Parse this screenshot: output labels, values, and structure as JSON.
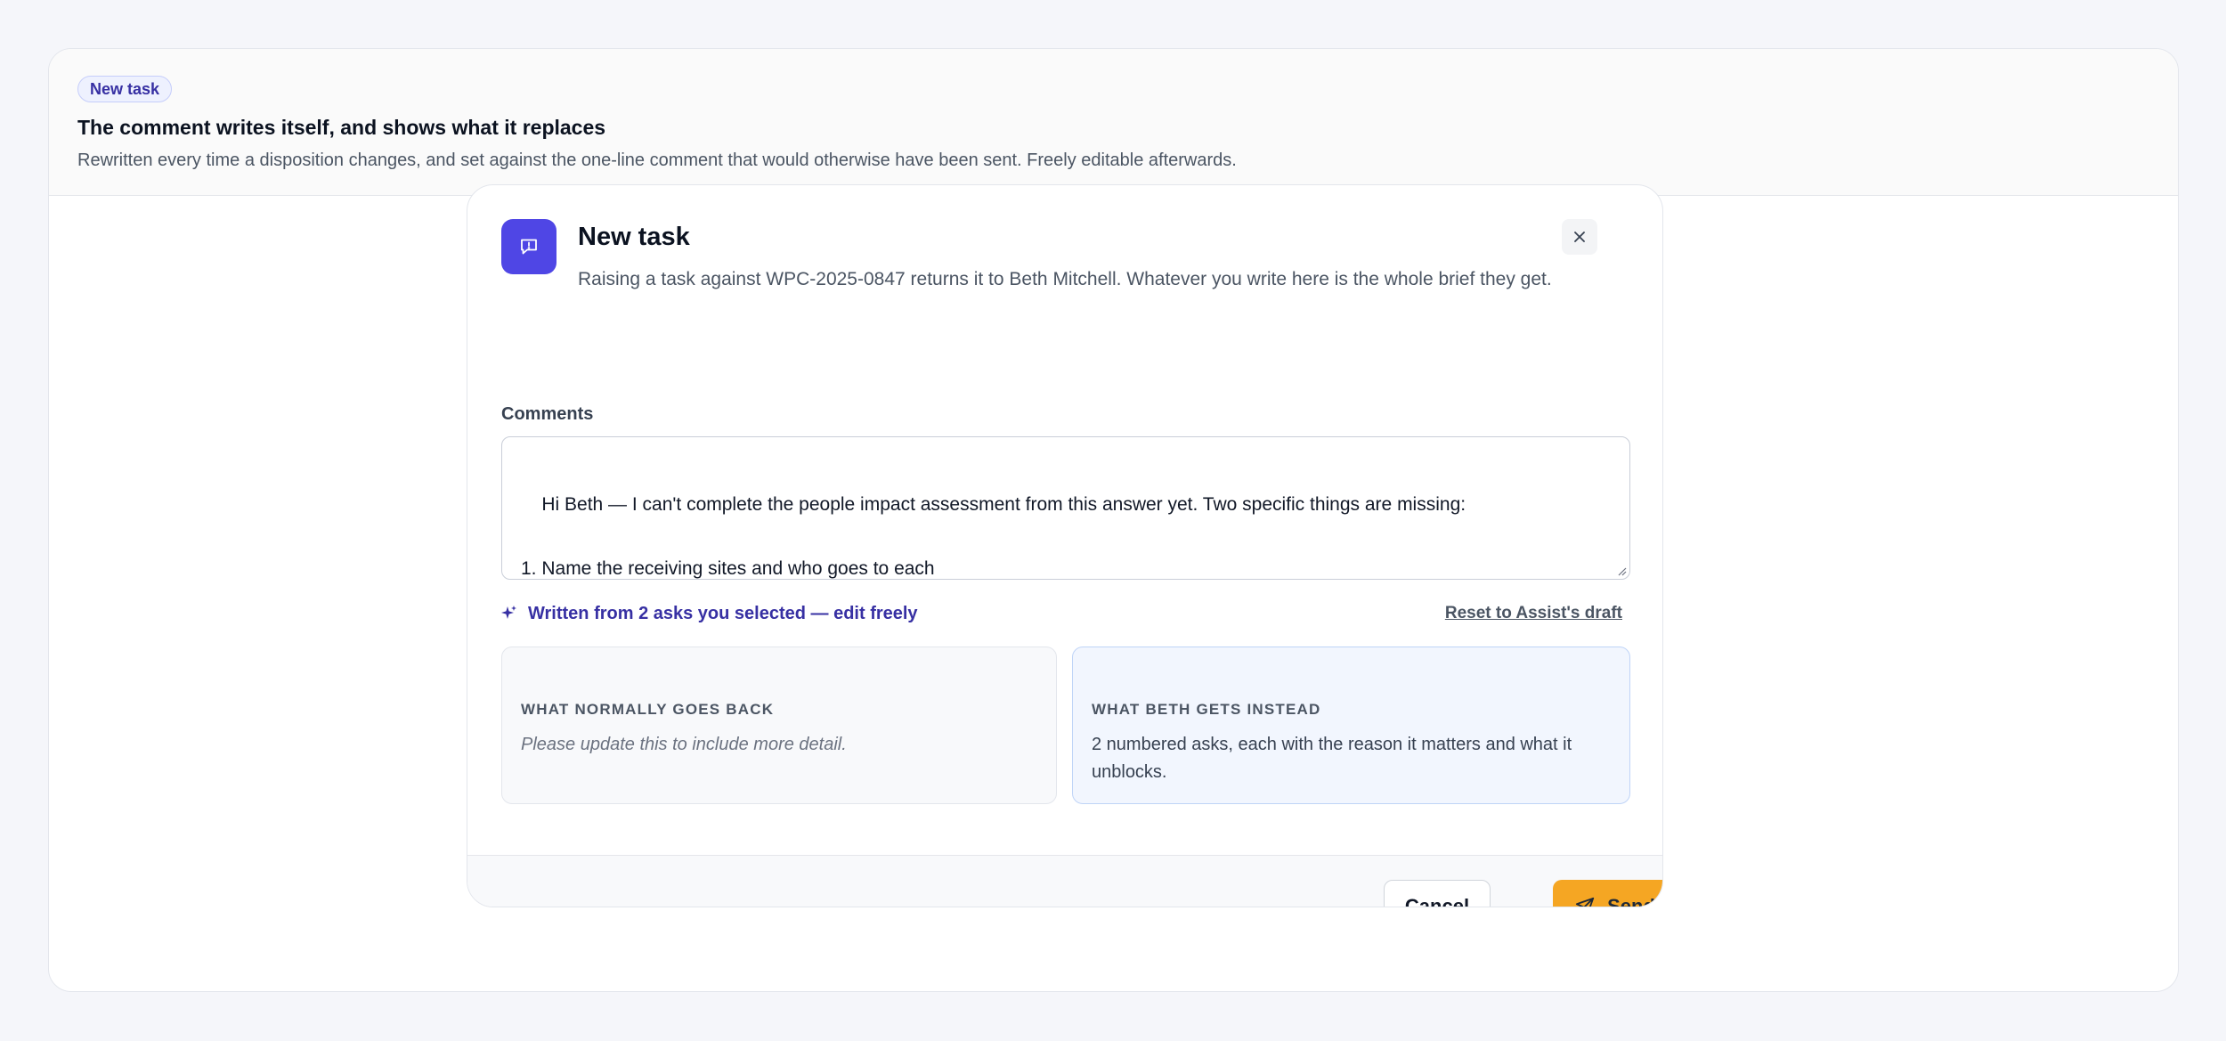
{
  "header": {
    "badge": "New task",
    "title": "The comment writes itself, and shows what it replaces",
    "subtitle": "Rewritten every time a disposition changes, and set against the one-line comment that would otherwise have been sent. Freely editable afterwards."
  },
  "modal": {
    "title": "New task",
    "description": "Raising a task against WPC-2025-0847 returns it to Beth Mitchell. Whatever you write here is the whole brief they get.",
    "app_icon": "message-flag-icon",
    "close_icon": "close-icon",
    "comments_label": "Comments",
    "comments_value": "Hi Beth — I can't complete the people impact assessment from this answer yet. Two specific things are missing:\n\n1. Name the receiving sites and who goes to each\n   “Newly leased regional offices” cannot be assessed. HRBP needs the sites named and the headcount split across",
    "assist_icon": "sparkle-icon",
    "assist_text": "Written from 2 asks you selected — edit freely",
    "reset_label": "Reset to Assist's draft",
    "comparison": {
      "left_label": "WHAT NORMALLY GOES BACK",
      "left_text": "Please update this to include more detail.",
      "right_label": "WHAT BETH GETS INSTEAD",
      "right_text": "2 numbered asks, each with the reason it matters and what it unblocks."
    },
    "cancel_label": "Cancel",
    "send_label": "Send",
    "send_icon": "send-icon"
  },
  "colors": {
    "accent": "#4f46e5",
    "assist_text": "#3730a3",
    "send_button": "#f5a623",
    "right_card_bg": "#f2f6fe",
    "right_card_border": "#bfd4f7"
  }
}
